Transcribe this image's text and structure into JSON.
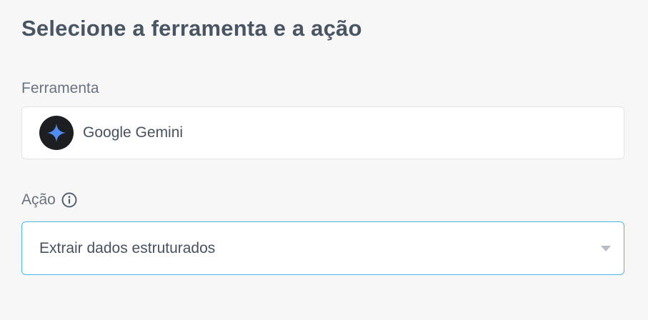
{
  "title": "Selecione a ferramenta e a ação",
  "tool": {
    "label": "Ferramenta",
    "name": "Google Gemini",
    "icon": "gemini-sparkle-icon",
    "icon_color": "#4f8ef7",
    "icon_background": "#1c1e22"
  },
  "action": {
    "label": "Ação",
    "info_icon": "info-icon",
    "selected": "Extrair dados estruturados",
    "dropdown_icon": "chevron-down-icon",
    "focus_color": "#4fb4ea"
  }
}
